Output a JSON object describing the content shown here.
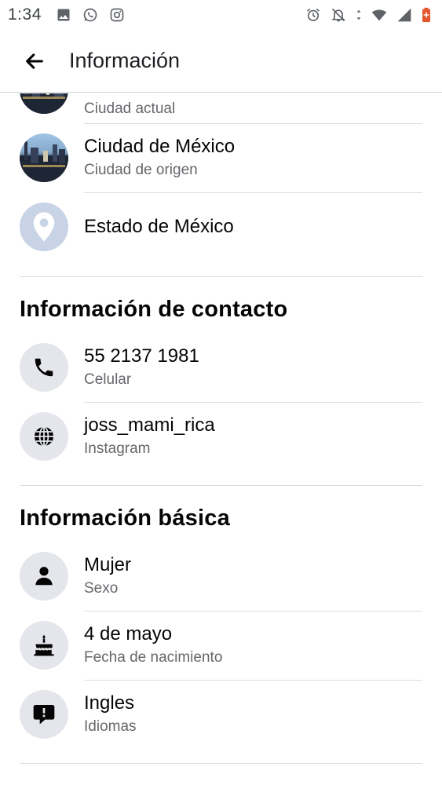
{
  "status_bar": {
    "time": "1:34",
    "left_icons": [
      "image-icon",
      "whatsapp-icon",
      "instagram-icon"
    ],
    "right_icons": [
      "alarm-icon",
      "notifications-off-icon",
      "wifi-icon",
      "signal-icon",
      "battery-icon"
    ]
  },
  "app_bar": {
    "title": "Información"
  },
  "places": [
    {
      "primary": "",
      "secondary": "Ciudad actual",
      "icon": "city-photo"
    },
    {
      "primary": "Ciudad de México",
      "secondary": "Ciudad de origen",
      "icon": "city-photo"
    },
    {
      "primary": "Estado de México",
      "secondary": "",
      "icon": "location-pin-icon"
    }
  ],
  "contact": {
    "title": "Información de contacto",
    "items": [
      {
        "primary": "55 2137 1981",
        "secondary": "Celular",
        "icon": "phone-icon"
      },
      {
        "primary": "joss_mami_rica",
        "secondary": "Instagram",
        "icon": "globe-icon"
      }
    ]
  },
  "basic": {
    "title": "Información básica",
    "items": [
      {
        "primary": "Mujer",
        "secondary": "Sexo",
        "icon": "person-icon"
      },
      {
        "primary": "4 de mayo",
        "secondary": "Fecha de nacimiento",
        "icon": "cake-icon"
      },
      {
        "primary": "Ingles",
        "secondary": "Idiomas",
        "icon": "speech-bubble-icon"
      }
    ]
  },
  "colors": {
    "primary_text": "#050505",
    "secondary_text": "#65676b",
    "icon_circle": "#e4e6eb",
    "divider": "#dadde1",
    "pin_circle": "#c8d3e6"
  }
}
